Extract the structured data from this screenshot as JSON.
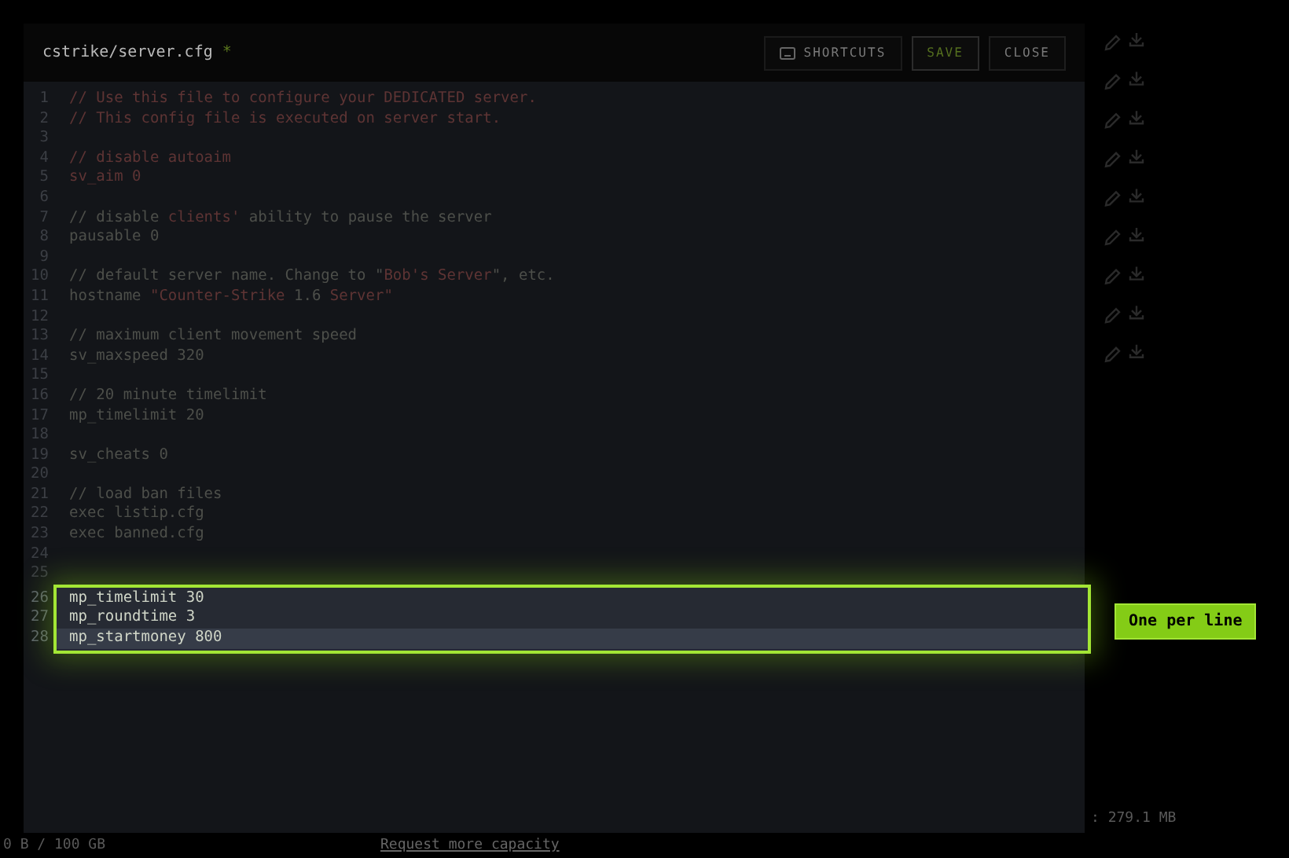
{
  "background": {
    "usage": "0 B / 100 GB",
    "capacity_link": "Request more capacity",
    "size_reading": ": 279.1 MB"
  },
  "editor": {
    "file_path": "cstrike/server.cfg",
    "modified_mark": "*",
    "buttons": [
      {
        "kind": "shortcuts",
        "label": "SHORTCUTS"
      },
      {
        "kind": "save",
        "label": "SAVE"
      },
      {
        "kind": "close",
        "label": "CLOSE"
      }
    ],
    "lines": [
      {
        "number": "1",
        "segments": [
          {
            "kind": "string",
            "text": "// Use this file to configure your DEDICATED server."
          }
        ]
      },
      {
        "number": "2",
        "segments": [
          {
            "kind": "string",
            "text": "// This config file is executed on server start."
          }
        ]
      },
      {
        "number": "3"
      },
      {
        "number": "4",
        "segments": [
          {
            "kind": "string",
            "text": "// disable autoaim"
          }
        ]
      },
      {
        "number": "5",
        "segments": [
          {
            "kind": "string",
            "text": "sv_aim 0"
          }
        ]
      },
      {
        "number": "6"
      },
      {
        "number": "7",
        "segments": [
          {
            "kind": "plain",
            "text": "// disable "
          },
          {
            "kind": "string",
            "text": "clients'"
          },
          {
            "kind": "plain",
            "text": " ability to pause the server"
          }
        ]
      },
      {
        "number": "8",
        "segments": [
          {
            "kind": "plain",
            "text": "pausable 0"
          }
        ]
      },
      {
        "number": "9"
      },
      {
        "number": "10",
        "segments": [
          {
            "kind": "plain",
            "text": "// default server name. Change to \""
          },
          {
            "kind": "string",
            "text": "Bob's Server"
          },
          {
            "kind": "plain",
            "text": "\", etc."
          }
        ]
      },
      {
        "number": "11",
        "segments": [
          {
            "kind": "plain",
            "text": "hostname "
          },
          {
            "kind": "string",
            "text": "\"Counter-Strike "
          },
          {
            "kind": "plain",
            "text": "1.6"
          },
          {
            "kind": "string",
            "text": " Server\""
          }
        ]
      },
      {
        "number": "12"
      },
      {
        "number": "13",
        "segments": [
          {
            "kind": "plain",
            "text": "// maximum client movement speed"
          }
        ]
      },
      {
        "number": "14",
        "segments": [
          {
            "kind": "plain",
            "text": "sv_maxspeed 320"
          }
        ]
      },
      {
        "number": "15"
      },
      {
        "number": "16",
        "segments": [
          {
            "kind": "plain",
            "text": "// 20 minute timelimit"
          }
        ]
      },
      {
        "number": "17",
        "segments": [
          {
            "kind": "plain",
            "text": "mp_timelimit 20"
          }
        ]
      },
      {
        "number": "18"
      },
      {
        "number": "19",
        "segments": [
          {
            "kind": "plain",
            "text": "sv_cheats 0"
          }
        ]
      },
      {
        "number": "20"
      },
      {
        "number": "21",
        "segments": [
          {
            "kind": "plain",
            "text": "// load ban files"
          }
        ]
      },
      {
        "number": "22",
        "segments": [
          {
            "kind": "plain",
            "text": "exec listip.cfg"
          }
        ]
      },
      {
        "number": "23",
        "segments": [
          {
            "kind": "plain",
            "text": "exec banned.cfg"
          }
        ]
      },
      {
        "number": "24"
      },
      {
        "number": "25"
      },
      {
        "number": "26",
        "highlighted": true,
        "current": false,
        "segments": [
          {
            "kind": "plain",
            "text": "mp_timelimit 30"
          }
        ]
      },
      {
        "number": "27",
        "highlighted": true,
        "current": false,
        "segments": [
          {
            "kind": "plain",
            "text": "mp_roundtime 3"
          }
        ]
      },
      {
        "number": "28",
        "highlighted": true,
        "current": true,
        "segments": [
          {
            "kind": "plain",
            "text": "mp_startmoney 800"
          }
        ]
      }
    ],
    "callout": "One per line"
  }
}
